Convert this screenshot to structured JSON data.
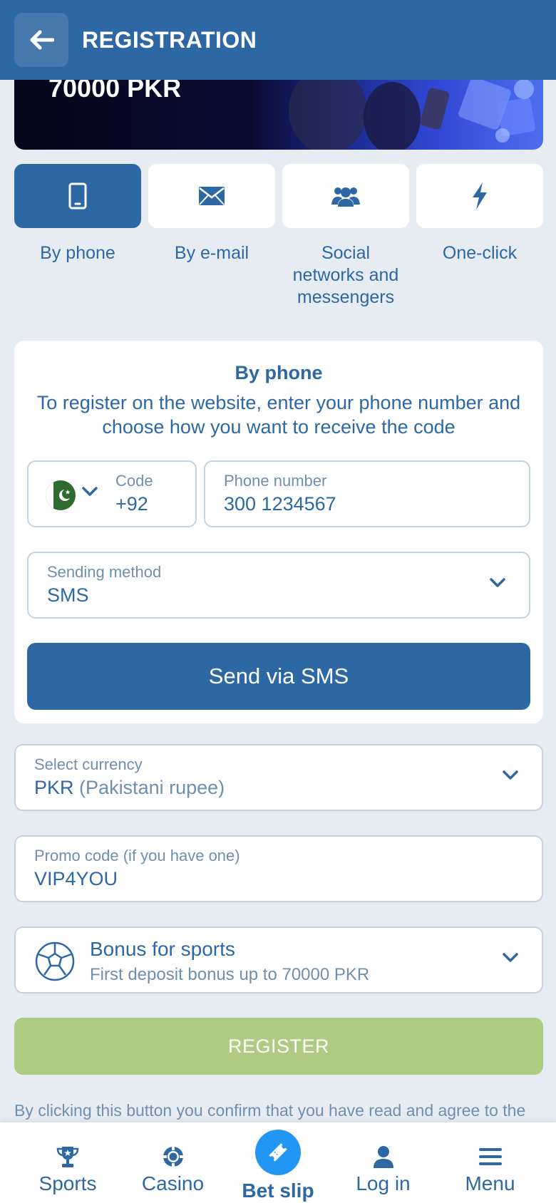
{
  "header": {
    "title": "REGISTRATION",
    "back_icon": "arrow-left-icon"
  },
  "banner": {
    "amount": "70000 PKR"
  },
  "tabs": [
    {
      "label": "By phone",
      "icon": "phone-icon",
      "active": true
    },
    {
      "label": "By e-mail",
      "icon": "envelope-icon",
      "active": false
    },
    {
      "label": "Social networks and messengers",
      "icon": "users-icon",
      "active": false
    },
    {
      "label": "One-click",
      "icon": "lightning-icon",
      "active": false
    }
  ],
  "phone_card": {
    "title": "By phone",
    "description": "To register on the website, enter your phone number and choose how you want to receive the code",
    "code_label": "Code",
    "code_value": "+92",
    "phone_label": "Phone number",
    "phone_value": "300 1234567",
    "method_label": "Sending method",
    "method_value": "SMS",
    "send_button": "Send via SMS"
  },
  "currency": {
    "label": "Select currency",
    "code": "PKR",
    "name": "(Pakistani rupee)"
  },
  "promo": {
    "label": "Promo code (if you have one)",
    "value": "VIP4YOU"
  },
  "bonus": {
    "title": "Bonus for sports",
    "subtitle": "First deposit bonus up to 70000 PKR",
    "icon": "soccer-ball-icon"
  },
  "register_button": "REGISTER",
  "terms": "By clicking this button you confirm that you have read and agree to the",
  "bottom_nav": [
    {
      "label": "Sports",
      "icon": "trophy-icon"
    },
    {
      "label": "Casino",
      "icon": "casino-chip-icon"
    },
    {
      "label": "Bet slip",
      "icon": "ticket-icon"
    },
    {
      "label": "Log in",
      "icon": "user-icon"
    },
    {
      "label": "Menu",
      "icon": "hamburger-icon"
    }
  ],
  "colors": {
    "primary": "#2e68a4",
    "background": "#e6ecf2",
    "register_disabled": "#adcc82",
    "betslip_accent": "#2196f3"
  }
}
